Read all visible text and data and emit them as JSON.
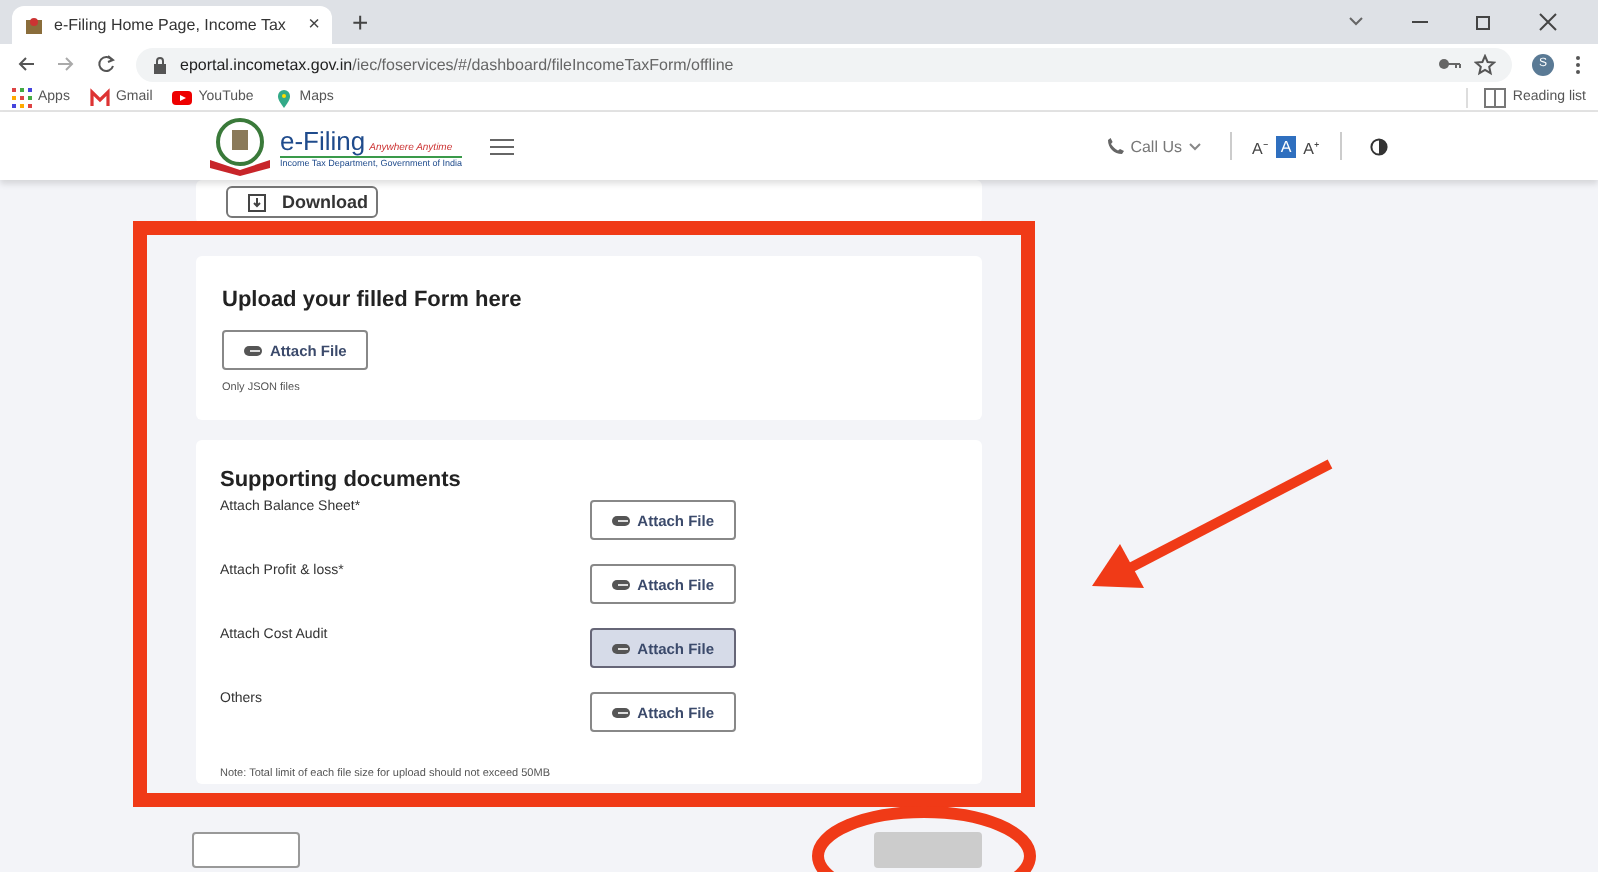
{
  "browser": {
    "tab_title": "e-Filing Home Page, Income Tax",
    "tab_close": "×",
    "new_tab": "+",
    "url_host": "eportal.incometax.gov.in",
    "url_path": "/iec/foservices/#/dashboard/fileIncomeTaxForm/offline",
    "profile_initial": "S",
    "bookmarks": [
      {
        "kind": "apps",
        "label": "Apps"
      },
      {
        "kind": "gmail",
        "label": "Gmail"
      },
      {
        "kind": "youtube",
        "label": "YouTube"
      },
      {
        "kind": "maps",
        "label": "Maps"
      }
    ],
    "reading_list": "Reading list"
  },
  "site_header": {
    "logo_title": "e-Filing",
    "logo_tagline": "Anywhere Anytime",
    "logo_subtitle": "Income Tax Department, Government of India",
    "call_us": "Call Us",
    "font_controls": [
      {
        "label": "A⁻",
        "selected": false
      },
      {
        "label": "A",
        "selected": true
      },
      {
        "label": "A⁺",
        "selected": false
      }
    ]
  },
  "download_card": {
    "button": "Download"
  },
  "upload_card": {
    "title": "Upload your filled Form here",
    "button": "Attach File",
    "hint": "Only JSON files"
  },
  "documents_card": {
    "title": "Supporting documents",
    "rows": [
      {
        "label": "Attach Balance Sheet*",
        "button": "Attach File",
        "hovered": false
      },
      {
        "label": "Attach Profit & loss*",
        "button": "Attach File",
        "hovered": false
      },
      {
        "label": "Attach Cost Audit",
        "button": "Attach File",
        "hovered": true
      },
      {
        "label": "Others",
        "button": "Attach File",
        "hovered": false
      }
    ],
    "note": "Note: Total limit of each file size for upload should not exceed 50MB"
  },
  "annotations": [
    {
      "kind": "rectangle",
      "color": "#f03a17"
    },
    {
      "kind": "arrow",
      "color": "#f03a17"
    },
    {
      "kind": "ellipse",
      "color": "#f03a17"
    }
  ]
}
